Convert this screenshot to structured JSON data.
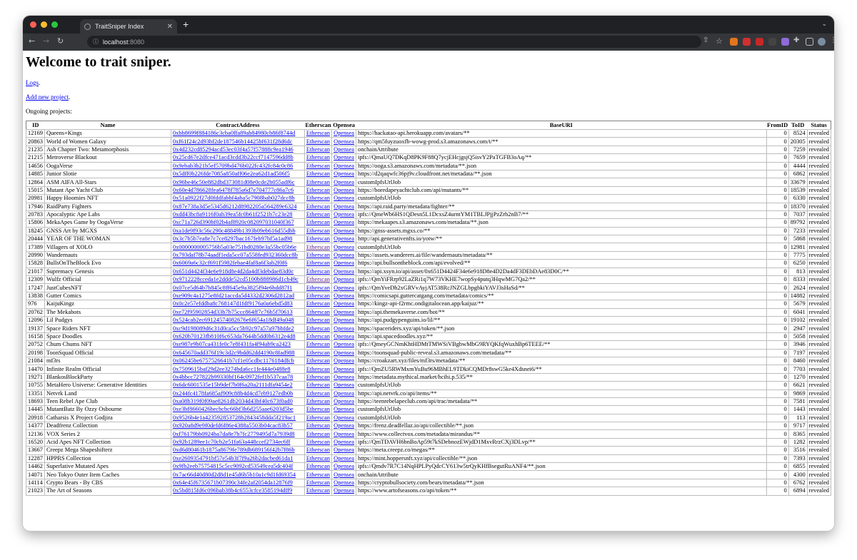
{
  "browser": {
    "tab_title": "TraitSniper Index",
    "url_host": "localhost",
    "url_port": ":8080"
  },
  "colors": {
    "link": "#0000ee",
    "visited": "#551a8b",
    "chrome_dark": "#202124",
    "chrome_toolbar": "#35363a",
    "traffic_red": "#ff5f57",
    "traffic_yellow": "#febc2e",
    "traffic_green": "#28c840"
  },
  "icons": {
    "back": "arrow-left-icon",
    "forward": "arrow-right-icon",
    "reload": "reload-icon",
    "lock": "info-icon",
    "star": "star-icon",
    "extensions": "puzzle-icon",
    "menu": "kebab-menu-icon"
  },
  "page": {
    "heading": "Welcome to trait sniper.",
    "logs_link": "Logs",
    "logs_suffix": ".",
    "add_link": "Add new project",
    "add_suffix": ".",
    "ongoing_label": "Ongoing projects:"
  },
  "table": {
    "headers": {
      "id": "ID",
      "name": "Name",
      "contract": "ContractAddress",
      "etherscan": "Etherscan",
      "opensea": "Opensea",
      "baseuri": "BaseURI",
      "fromid": "FromID",
      "toid": "ToID",
      "status": "Status"
    },
    "etherscan_label": "Etherscan",
    "opensea_label": "Opensea",
    "rows": [
      {
        "id": "12169",
        "name": "Queens+Kings",
        "contract": "0xbb8699f884186c3cba0ffa89ab84980cb86f8744d",
        "uri": "https://hackatao-api.herokuapp.com/avatars/**",
        "from": "0",
        "to": "8524",
        "status": "revealed",
        "ev": false
      },
      {
        "id": "20863",
        "name": "World of Women Galaxy",
        "contract": "0xf61f24c2d93bf2de187546b14425bf631f28d6dc",
        "uri": "https://qm5fuyzuoxfb-wowg-prod.s3.amazonaws.com/t/**",
        "from": "0",
        "to": "20305",
        "status": "revealed",
        "ev": false
      },
      {
        "id": "21235",
        "name": "Ash Chapter Two: Metamorphosis",
        "contract": "0x4d232cd85294acd53ec03f4a57f57888c9ea1946",
        "uri": "onchainAttribute",
        "from": "0",
        "to": "7259",
        "status": "revealed",
        "ev": false
      },
      {
        "id": "21215",
        "name": "Metroverse Blackout",
        "contract": "0x25cd67e2dfce471acd3cdd3b22ccf7147596dd8b",
        "uri": "ipfs://QmaUQ7DKqD8PK9F88Q7ycjEHcjgsjQ5isvY2PaTGFB3oAq/**",
        "from": "0",
        "to": "7659",
        "status": "revealed",
        "ev": false
      },
      {
        "id": "14656",
        "name": "OogaVerse",
        "contract": "0x9ebab3b21b5ef5709bd476b022fc432fc84c0c86",
        "uri": "https://ooga.s3.amazonaws.com/metadata/**.json",
        "from": "0",
        "to": "4444",
        "status": "revealed",
        "ev": false
      },
      {
        "id": "14885",
        "name": "Junior Slotie",
        "contract": "0x5dff0b226fde7085a850aff06e2ea62d1ad506f5",
        "uri": "https://d2qaqwfc36pj9v.cloudfront.net/metadata/**.json",
        "from": "0",
        "to": "6862",
        "status": "revealed",
        "ev": false
      },
      {
        "id": "12864",
        "name": "ASM AIFA All-Stars",
        "contract": "0x96be46c50e882dbd373081d08e0cde2b055adf6c",
        "uri": "customIpfsUrlJob",
        "from": "0",
        "to": "33679",
        "status": "revealed",
        "ev": false
      },
      {
        "id": "15015",
        "name": "Mutant Ape Yacht Club",
        "contract": "0x60e4d786628fea6478f785a6d7e704777c86a7c6",
        "uri": "https://boredapeyachtclub.com/api/mutants/**",
        "from": "0",
        "to": "18539",
        "status": "revealed",
        "ev": false
      },
      {
        "id": "20981",
        "name": "Happy Hoomies NFT",
        "contract": "0x51a0922f27d0fddfabbf4aba5c7908bab027dcc8b",
        "uri": "customIpfsUrlJob",
        "from": "0",
        "to": "6330",
        "status": "revealed",
        "ev": false
      },
      {
        "id": "17946",
        "name": "RaidParty Fighters",
        "contract": "0x87e738a3d5e5345d6212d8982205a564289e6324",
        "uri": "https://api.raid.party/metadata/fighter/**",
        "from": "0",
        "to": "18370",
        "status": "revealed",
        "ev": false
      },
      {
        "id": "20783",
        "name": "Apocalyptic Ape Labs",
        "contract": "0xdd43bc8a9116f0ab39ea5fc0b61f2521b7c23e28",
        "uri": "ipfs://QmeWb6HS1QDesn5L1DcxsZ4urntYM1TBLJPjjPzZrb2nB7/**",
        "from": "0",
        "to": "7037",
        "status": "revealed",
        "ev": false
      },
      {
        "id": "15806",
        "name": "MekaApes Game by OogaVerse",
        "contract": "0xc71a726d390bf02b4af8920c082097031040f367",
        "uri": "https://mekaapes.s3.amazonaws.com/metadata/**.json",
        "from": "0",
        "to": "89792",
        "status": "revealed",
        "ev": false
      },
      {
        "id": "18245",
        "name": "GNSS Art by MGXS",
        "contract": "0xa1de9f93c56c290c48849b1393b09eb616d55dbb",
        "uri": "https://gnss-assets.mgxs.co/**",
        "from": "0",
        "to": "7233",
        "status": "revealed",
        "ev": false
      },
      {
        "id": "20444",
        "name": "YEAR OF THE WOMAN",
        "contract": "0x3c7b5b7ea8e7c7ce8297bac167feb97bf5a1ad98",
        "uri": "http://api.generativenfts.io/yotw/**",
        "from": "0",
        "to": "5868",
        "status": "revealed",
        "ev": false
      },
      {
        "id": "17389",
        "name": "Villagers of XOLO",
        "contract": "0x0000000005756b5a03e751bd0280e3a55bc05b6e",
        "uri": "customIpfsUrlJob",
        "from": "0",
        "to": "12981",
        "status": "revealed",
        "ev": true
      },
      {
        "id": "20990",
        "name": "Wandernauts",
        "contract": "0x793daf78b74aadf1eda5cc07a558fed932360dcc8b",
        "uri": "https://assets.wanderers.ai/file/wandernauts/metadata/**",
        "from": "0",
        "to": "7775",
        "status": "revealed",
        "ev": false
      },
      {
        "id": "15828",
        "name": "BullsOnTheBlock Evo",
        "contract": "0x6069a6c32cf691f5982febae4faf8a6f3ab2f0f6",
        "uri": "https://api.bullsontheblock.com/api/evolved/**",
        "from": "0",
        "to": "6250",
        "status": "revealed",
        "ev": false
      },
      {
        "id": "21017",
        "name": "Supremacy Genesis",
        "contract": "0x651d4424f34e6e918d8e4d2da4df3debdae83d0c",
        "uri": "https://api.xsyn.io/api/asset/0x651D4424F34e6e918D8e4D2Da4dF3DEbDAe83D0C/**",
        "from": "0",
        "to": "813",
        "status": "revealed",
        "ev": false
      },
      {
        "id": "12309",
        "name": "Wulfz Official",
        "contract": "0x9712228cceda1e2ddde52cd5100b888986d1cb49c",
        "uri": "ipfs://QmYiFRrp92LaZRi1q7W73VKHE7wopSy4putq3HqwMG7Qa2/**",
        "from": "0",
        "to": "8333",
        "status": "revealed",
        "ev": true
      },
      {
        "id": "17247",
        "name": "JustCubesNFT",
        "contract": "0x07ce5d64b7b845c8ff645e9a3825f94e6bdd87f1",
        "uri": "ipfs://QmYveDh2xGRVvAyjAT538RcJNZGLbpgbkiYAVJ3sHaSd/**",
        "from": "0",
        "to": "2624",
        "status": "revealed",
        "ev": false
      },
      {
        "id": "13838",
        "name": "Gutter Comics",
        "contract": "0xe909c4a1275e8fd21accda5d4332d2306d2812ad",
        "uri": "https://comicsapi.guttercatgang.com/metadata/comics/**",
        "from": "0",
        "to": "14882",
        "status": "revealed",
        "ev": false
      },
      {
        "id": "976",
        "name": "KaijuKingz",
        "contract": "0x0c2e57efddba8c768147d1fdf9176a0a6ebd5d83",
        "uri": "https://kingz-api-f2rmc.ondigitalocean.app/kaijuz/**",
        "from": "0",
        "to": "5679",
        "status": "revealed",
        "ev": false
      },
      {
        "id": "20762",
        "name": "The Mekabots",
        "contract": "0xe72f95902854d33b7b75ccc864ff7c76b5f70613",
        "uri": "https://api.themekaverse.com/bot/**",
        "from": "0",
        "to": "6041",
        "status": "revealed",
        "ev": false
      },
      {
        "id": "12096",
        "name": "Lil Pudgys",
        "contract": "0x524cab2ec69124574082676e6f654a18df49a048",
        "uri": "https://api.pudgypenguins.io/lil/**",
        "from": "0",
        "to": "19102",
        "status": "revealed",
        "ev": false
      },
      {
        "id": "19137",
        "name": "Space Riders NFT",
        "contract": "0xc9d198089d6c31d0ca5cc5b92c97a57a97bbfde2",
        "uri": "https://spaceriders.xyz/api/token/**.json",
        "from": "0",
        "to": "2947",
        "status": "revealed",
        "ev": false
      },
      {
        "id": "16158",
        "name": "Space Doodles",
        "contract": "0x620b70123fb810f6c653da7644b5dd0b6312e4d8",
        "uri": "https://api.spacedoodles.xyz/**",
        "from": "0",
        "to": "5058",
        "status": "revealed",
        "ev": false
      },
      {
        "id": "20752",
        "name": "Chum Chums NFT",
        "contract": "0xe987e9b07ca431fe0c7e8f431fa4f94ab9ca2423",
        "uri": "ipfs://QmeyGCNmKhtHDMtTMWSiVBgbwMbG9RYQKfqWuxhBp6TEEE/**",
        "from": "0",
        "to": "3946",
        "status": "revealed",
        "ev": false
      },
      {
        "id": "20198",
        "name": "ToonSquad Official",
        "contract": "0x645670add376f19c3d2c9bdd62dd4190c8fad988",
        "uri": "https://toonsquad-public-reveal.s3.amazonaws.com/metadata/**",
        "from": "0",
        "to": "7197",
        "status": "revealed",
        "ev": false
      },
      {
        "id": "21084",
        "name": "mf3rs",
        "contract": "0x06245be6757526641b7cf1e05cdbc1176184dfcb",
        "uri": "https://croakzart.xyz/files/mf3rs/metadata/**",
        "from": "0",
        "to": "8460",
        "status": "revealed",
        "ev": false
      },
      {
        "id": "14470",
        "name": "Infinite Realm Official",
        "contract": "0x7509615baf29d2ee3274bda6cc1fe444e0488e8",
        "uri": "ipfs://QmZU5RWMxmYuBu96MBhEL9TDkiCQMDr8swG5ke4Xdsnei6/**",
        "from": "0",
        "to": "7703",
        "status": "revealed",
        "ev": false
      },
      {
        "id": "19271",
        "name": "BlankosBlockParty",
        "contract": "0x4bbcc727822b99330bf164c0972fef1b537caa78",
        "uri": "https://metadata.mythical.market/hcihi.p.535/**",
        "from": "0",
        "to": "1270",
        "status": "revealed",
        "ev": false
      },
      {
        "id": "10755",
        "name": "MetaHero Universe: Generative Identities",
        "contract": "0x6dc6001535e15b9def7b0f6a20a2111dfa9454e2",
        "uri": "customIpfsUrlJob",
        "from": "0",
        "to": "6621",
        "status": "revealed",
        "ev": false
      },
      {
        "id": "13351",
        "name": "Netvrk Land",
        "contract": "0x244fc4178fa685af909c88b4d4cd7eb9127edb0b",
        "uri": "https://api.netvrk.co/api/items/**",
        "from": "0",
        "to": "9869",
        "status": "revealed",
        "ev": false
      },
      {
        "id": "18693",
        "name": "Teen Rebel Ape Club",
        "contract": "0xa08b319f0f09ae8261db2034d43bf40c673f0ad0",
        "uri": "https://teenrebelapeclub.com/api/trac/metadata/**",
        "from": "0",
        "to": "7581",
        "status": "revealed",
        "ev": false
      },
      {
        "id": "14445",
        "name": "MutantBatz By Ozzy Osbourne",
        "contract": "0xe3bf8660426becbcbc66bf3b6d255aae6203d5be",
        "uri": "customIpfsUrlJob",
        "from": "0",
        "to": "1443",
        "status": "revealed",
        "ev": false
      },
      {
        "id": "20918",
        "name": "Catharsis X Project Godjira",
        "contract": "0x9526b4e1a423592853728b2843458dda5f219ac1",
        "uri": "customIpfsUrlJob",
        "from": "0",
        "to": "113",
        "status": "revealed",
        "ev": false
      },
      {
        "id": "14377",
        "name": "Deadfrenz Collection",
        "contract": "0x920a8d9e9f0defd6f86e4388a5503b04cac83b57",
        "uri": "https://frenz.deadfellaz.io/api/collectible/**.json",
        "from": "0",
        "to": "9717",
        "status": "revealed",
        "ev": false
      },
      {
        "id": "12136",
        "name": "VOX Series 2",
        "contract": "0xf76179bb0924ba7da8e7b7fc2779495d7a7939d8",
        "uri": "https://www.collectvox.com/metadata/mirandus/**",
        "from": "0",
        "to": "8365",
        "status": "revealed",
        "ev": false
      },
      {
        "id": "16520",
        "name": "Acid Apes NFT Collection",
        "contract": "0x92b1289ee1c70cb2e51fa63a448ccef2734ec6ff",
        "uri": "ipfs://QmTDAVH6bnBoAp59t7kSDebnozEWjdD1MxvRrzCXj3DLvp/**",
        "from": "0",
        "to": "1282",
        "status": "revealed",
        "ev": false
      },
      {
        "id": "13667",
        "name": "Creepz Mega Shapeshifterz",
        "contract": "0xd6d80461b1875a8679fe789db689156f42b7f86b",
        "uri": "https://meta.creepz.co/megas/**",
        "from": "0",
        "to": "3516",
        "status": "revealed",
        "ev": false
      },
      {
        "id": "12287",
        "name": "HPPRS Collection",
        "contract": "0xe2609354791bf57e54b3f7f9a26b2dacbed61da1",
        "uri": "https://mint.hoppersnft.xyz/api/collectible/**.json",
        "from": "0",
        "to": "7393",
        "status": "revealed",
        "ev": false
      },
      {
        "id": "14462",
        "name": "Superlative Mutated Apes",
        "contract": "0x9fb2eeb75754815c5cc9092cd53549cea5dc404f",
        "uri": "ipfs://Qmdv7R7C14NqHPLPyQdcCY613w5trQyKHfBsegutRuANF4/**.json",
        "from": "0",
        "to": "6855",
        "status": "revealed",
        "ev": false
      },
      {
        "id": "14071",
        "name": "Neo Tokyo Outer Item Caches",
        "contract": "0x7ac66d40d80d2d8d1e45d6b5b10a1c9d1fd69354",
        "uri": "onchainAttribute",
        "from": "0",
        "to": "4300",
        "status": "revealed",
        "ev": false
      },
      {
        "id": "14114",
        "name": "Crypto Bears - By CBS",
        "contract": "0x64e45f6735671b07390c34fe2af2054da12876f9",
        "uri": "https://cryptobullsociety.com/bears/metadata/**.json",
        "from": "0",
        "to": "6762",
        "status": "revealed",
        "ev": false
      },
      {
        "id": "21023",
        "name": "The Art of Seasons",
        "contract": "0x5bd815fd6c096bab38b4c6553cfce3585194dff9",
        "uri": "https://www.artofseasons.co/api/token/**",
        "from": "0",
        "to": "6894",
        "status": "revealed",
        "ev": false
      }
    ]
  }
}
